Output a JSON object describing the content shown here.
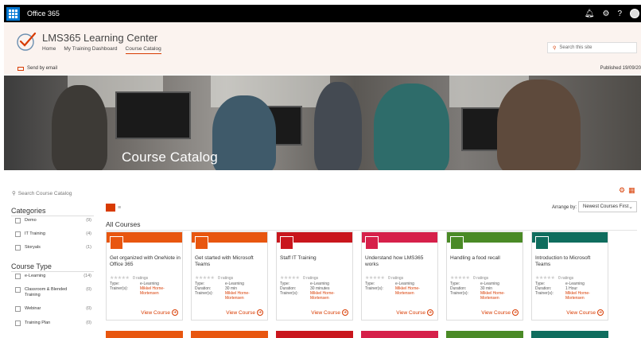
{
  "suitebar": {
    "title": "Office 365",
    "icons": [
      "waffle-icon",
      "bell-icon",
      "gear-icon",
      "help-icon",
      "avatar"
    ],
    "help_glyph": "?"
  },
  "site": {
    "name": "LMS365 Learning Center",
    "nav": [
      "Home",
      "My Training Dashboard",
      "Course Catalog"
    ],
    "active_nav": "Course Catalog",
    "search_placeholder": "Search this site"
  },
  "command": {
    "send_email": "Send by email",
    "published": "Published 19/09/20"
  },
  "hero": {
    "title": "Course Catalog"
  },
  "filters": {
    "search_placeholder": "Search Course Catalog",
    "categories_heading": "Categories",
    "categories": [
      {
        "label": "Demo",
        "count": "(9)"
      },
      {
        "label": "IT Training",
        "count": "(4)"
      },
      {
        "label": "Storyals",
        "count": "(1)"
      }
    ],
    "type_heading": "Course Type",
    "types": [
      {
        "label": "e-Learning",
        "count": "(14)"
      },
      {
        "label": "Classroom & Blended Training",
        "count": "(0)"
      },
      {
        "label": "Webinar",
        "count": "(0)"
      },
      {
        "label": "Training Plan",
        "count": "(0)"
      }
    ]
  },
  "main": {
    "arrange_label": "Arrange by:",
    "arrange_value": "Newest Courses First",
    "section_title": "All Courses",
    "list_glyph": "≡",
    "colors": {
      "accent": "#d83b01"
    }
  },
  "courses": [
    {
      "title": "Get organized with OneNote in Office 365",
      "color": "#e8560f",
      "stars": "★★★★★",
      "ratings": "0 ratings",
      "k1": "Type:",
      "v1": "e-Learning",
      "k2": "Trainer(s):",
      "v2": "Mikkel Horne-",
      "k3": "",
      "v3": "Mortensen",
      "k4": "",
      "v4": "",
      "view": "View Course"
    },
    {
      "title": "Get started with Microsoft Teams",
      "color": "#e8560f",
      "stars": "★★★★★",
      "ratings": "0 ratings",
      "k1": "Type:",
      "v1": "e-Learning",
      "k2": "Duration:",
      "v2": "30 min",
      "k3": "Trainer(s):",
      "v3": "Mikkel Horne-",
      "k4": "",
      "v4": "Mortensen",
      "view": "View Course"
    },
    {
      "title": "Staff IT Training",
      "color": "#c9161d",
      "stars": "★★★★★",
      "ratings": "0 ratings",
      "k1": "Type:",
      "v1": "e-Learning",
      "k2": "Duration:",
      "v2": "30 minutes",
      "k3": "Trainer(s):",
      "v3": "Mikkel Horne-",
      "k4": "",
      "v4": "Mortensen",
      "view": "View Course"
    },
    {
      "title": "Understand how LMS365 works",
      "color": "#d6204a",
      "stars": "★★★★★",
      "ratings": "0 ratings",
      "k1": "Type:",
      "v1": "e-Learning",
      "k2": "Trainer(s):",
      "v2": "Mikkel Horne-",
      "k3": "",
      "v3": "Mortensen",
      "k4": "",
      "v4": "",
      "view": "View Course"
    },
    {
      "title": "Handling a food recall",
      "color": "#4a8a26",
      "stars": "★★★★★",
      "ratings": "0 ratings",
      "k1": "Type:",
      "v1": "e-Learning",
      "k2": "Duration:",
      "v2": "30 min",
      "k3": "Trainer(s):",
      "v3": "Mikkel Horne-",
      "k4": "",
      "v4": "Mortensen",
      "view": "View Course"
    },
    {
      "title": "Introduction to Microsoft Teams",
      "color": "#0f6d5e",
      "stars": "★★★★★",
      "ratings": "0 ratings",
      "k1": "Type:",
      "v1": "e-Learning",
      "k2": "Duration:",
      "v2": "1 Hour",
      "k3": "Trainer(s):",
      "v3": "Mikkel Horne-",
      "k4": "",
      "v4": "Mortensen",
      "view": "View Course"
    }
  ],
  "next_row_colors": [
    "#e8560f",
    "#e8560f",
    "#c9161d",
    "#d6204a",
    "#4a8a26",
    "#0f6d5e"
  ]
}
